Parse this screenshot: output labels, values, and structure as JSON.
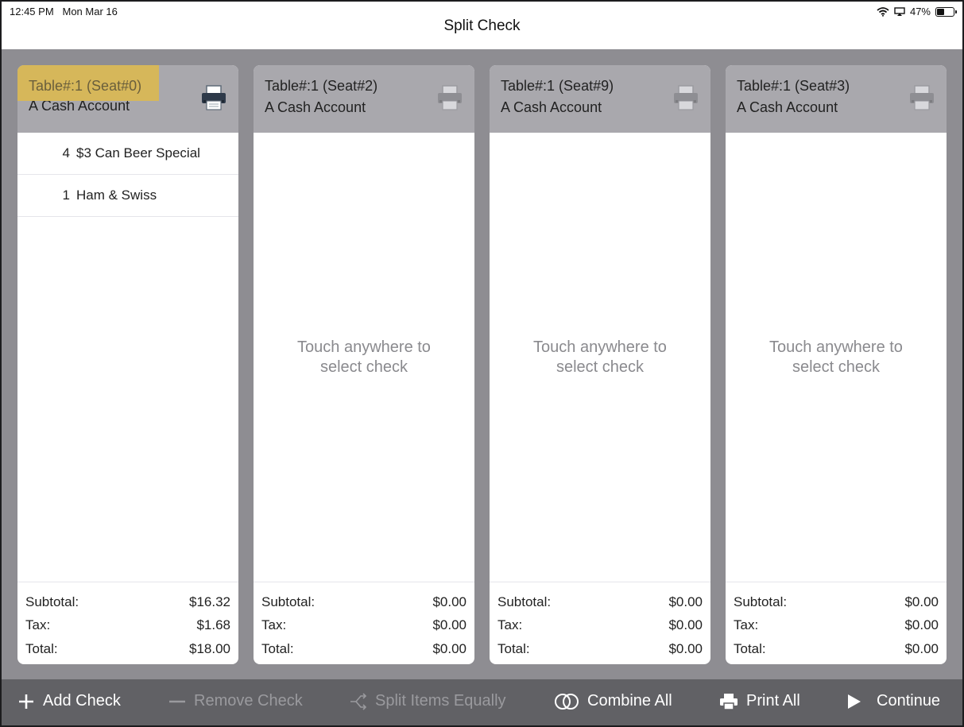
{
  "status": {
    "time": "12:45 PM",
    "date": "Mon Mar 16",
    "battery_percent_label": "47%",
    "battery_level": 0.47
  },
  "header": {
    "title": "Split Check"
  },
  "checks": [
    {
      "seat": "Table#:1 (Seat#0)",
      "account": "A Cash Account",
      "highlighted": true,
      "items": [
        {
          "qty": "4",
          "name": "$3 Can Beer Special"
        },
        {
          "qty": "1",
          "name": "Ham & Swiss"
        }
      ],
      "totals": {
        "subtotal_label": "Subtotal:",
        "subtotal": "$16.32",
        "tax_label": "Tax:",
        "tax": "$1.68",
        "total_label": "Total:",
        "total": "$18.00"
      }
    },
    {
      "seat": "Table#:1 (Seat#2)",
      "account": "A Cash Account",
      "empty_hint": "Touch anywhere to select check",
      "empty_hint_line1": "Touch anywhere to",
      "empty_hint_line2": "select check",
      "totals": {
        "subtotal_label": "Subtotal:",
        "subtotal": "$0.00",
        "tax_label": "Tax:",
        "tax": "$0.00",
        "total_label": "Total:",
        "total": "$0.00"
      }
    },
    {
      "seat": "Table#:1 (Seat#9)",
      "account": "A Cash Account",
      "empty_hint_line1": "Touch anywhere to",
      "empty_hint_line2": "select check",
      "totals": {
        "subtotal_label": "Subtotal:",
        "subtotal": "$0.00",
        "tax_label": "Tax:",
        "tax": "$0.00",
        "total_label": "Total:",
        "total": "$0.00"
      }
    },
    {
      "seat": "Table#:1 (Seat#3)",
      "account": "A Cash Account",
      "empty_hint_line1": "Touch anywhere to",
      "empty_hint_line2": "select check",
      "totals": {
        "subtotal_label": "Subtotal:",
        "subtotal": "$0.00",
        "tax_label": "Tax:",
        "tax": "$0.00",
        "total_label": "Total:",
        "total": "$0.00"
      }
    }
  ],
  "toolbar": {
    "add_check": "Add Check",
    "remove_check": "Remove Check",
    "split_items_equally": "Split Items Equally",
    "combine_all": "Combine All",
    "print_all": "Print All",
    "continue": "Continue"
  },
  "colors": {
    "highlight": "#d6b75a",
    "header_gray": "#a9a8ad",
    "background_gray": "#8e8d92",
    "toolbar_gray": "#616165"
  },
  "icons": [
    "wifi-icon",
    "airplay-icon",
    "battery-icon",
    "printer-icon",
    "plus-icon",
    "minus-icon",
    "split-icon",
    "combine-icon",
    "print-icon",
    "play-icon"
  ]
}
